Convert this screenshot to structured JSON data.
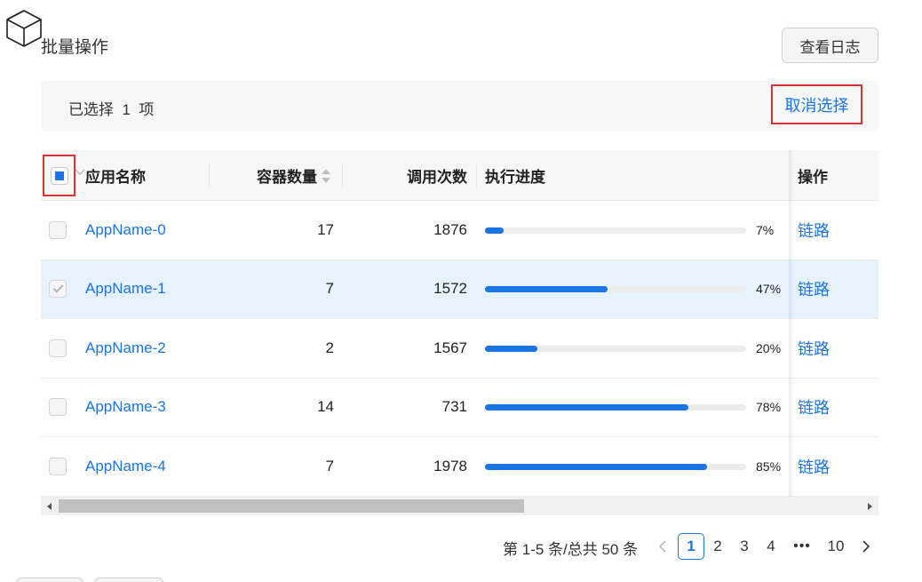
{
  "header": {
    "title": "批量操作",
    "log_button": "查看日志"
  },
  "selection": {
    "text": "已选择  1  项",
    "cancel_label": "取消选择"
  },
  "table": {
    "columns": {
      "name": "应用名称",
      "containers": "容器数量",
      "calls": "调用次数",
      "progress": "执行进度",
      "actions": "操作"
    },
    "header_checkbox_state": "indeterminate",
    "rows": [
      {
        "name": "AppName-0",
        "containers": "17",
        "calls": "1876",
        "progress": 7,
        "progress_label": "7%",
        "action": "链路",
        "selected": false
      },
      {
        "name": "AppName-1",
        "containers": "7",
        "calls": "1572",
        "progress": 47,
        "progress_label": "47%",
        "action": "链路",
        "selected": true
      },
      {
        "name": "AppName-2",
        "containers": "2",
        "calls": "1567",
        "progress": 20,
        "progress_label": "20%",
        "action": "链路",
        "selected": false
      },
      {
        "name": "AppName-3",
        "containers": "14",
        "calls": "731",
        "progress": 78,
        "progress_label": "78%",
        "action": "链路",
        "selected": false
      },
      {
        "name": "AppName-4",
        "containers": "7",
        "calls": "1978",
        "progress": 85,
        "progress_label": "85%",
        "action": "链路",
        "selected": false
      }
    ]
  },
  "scrollbar": {
    "position_fraction": 0.58
  },
  "pagination": {
    "summary": "第 1-5 条/总共 50 条",
    "pages": [
      "1",
      "2",
      "3",
      "4",
      "10"
    ],
    "current": "1",
    "ellipsis": "•••"
  },
  "colors": {
    "accent": "#1b74e4",
    "highlight_border": "#d9313a",
    "selected_row": "#e6f3fe"
  }
}
